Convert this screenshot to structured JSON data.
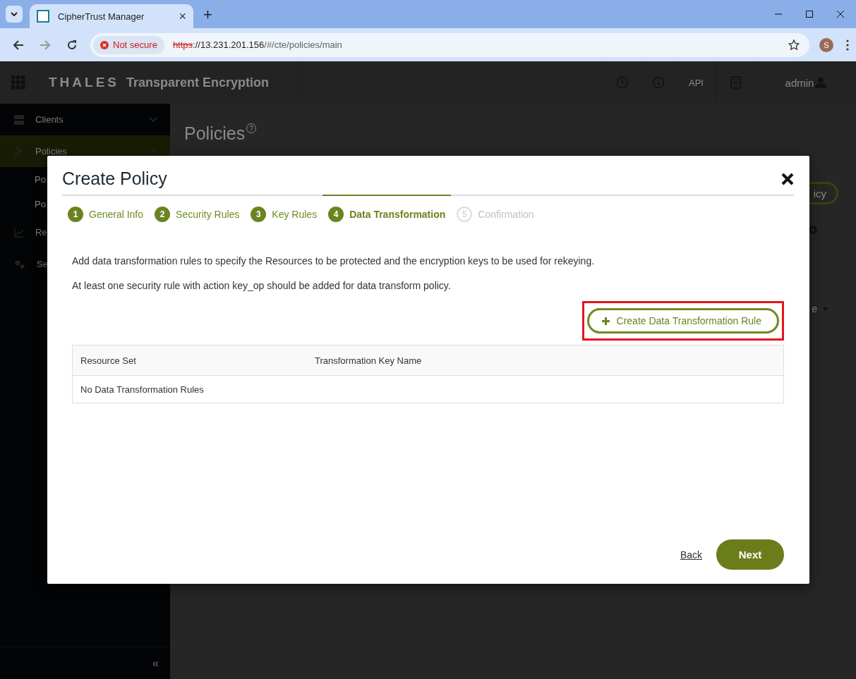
{
  "browser": {
    "tab": {
      "title": "CipherTrust Manager",
      "close": "×"
    },
    "new_tab": "+",
    "security_chip": "Not secure",
    "url": {
      "scheme": "https",
      "host": "://13.231.201.156",
      "path": "/#/cte/policies/main"
    },
    "avatar": "S"
  },
  "header": {
    "brand": "THALES",
    "product": "Transparent Encryption",
    "api": "API",
    "user": "admin"
  },
  "sidebar": {
    "items": [
      {
        "label": "Clients",
        "expanded": false,
        "selected": false
      },
      {
        "label": "Policies",
        "expanded": true,
        "selected": true,
        "children": [
          {
            "label": "Po"
          },
          {
            "label": "Po"
          }
        ]
      },
      {
        "label": "Re",
        "selected": false
      },
      {
        "label": "Se",
        "selected": false
      }
    ],
    "collapse": "«"
  },
  "page": {
    "title": "Policies",
    "help": "?",
    "button_fragment": "icy",
    "filter_fragment": "e"
  },
  "dialog": {
    "title": "Create Policy",
    "steps": [
      {
        "number": "1",
        "label": "General Info",
        "completed": true,
        "selected": false
      },
      {
        "number": "2",
        "label": "Security Rules",
        "completed": true,
        "selected": false
      },
      {
        "number": "3",
        "label": "Key Rules",
        "completed": true,
        "selected": false
      },
      {
        "number": "4",
        "label": "Data Transformation",
        "completed": false,
        "selected": true
      },
      {
        "number": "5",
        "label": "Confirmation",
        "completed": false,
        "selected": false
      }
    ],
    "paragraphs": [
      "Add data transformation rules to specify the Resources to be protected and the encryption keys to be used for rekeying.",
      "At least one security rule with action key_op should be added for data transform policy."
    ],
    "create_button": {
      "label": "Create Data Transformation Rule",
      "highlighted": true
    },
    "table": {
      "columns": [
        "Resource Set",
        "Transformation Key Name"
      ],
      "empty": "No Data Transformation Rules"
    },
    "back": "Back",
    "next": "Next"
  }
}
